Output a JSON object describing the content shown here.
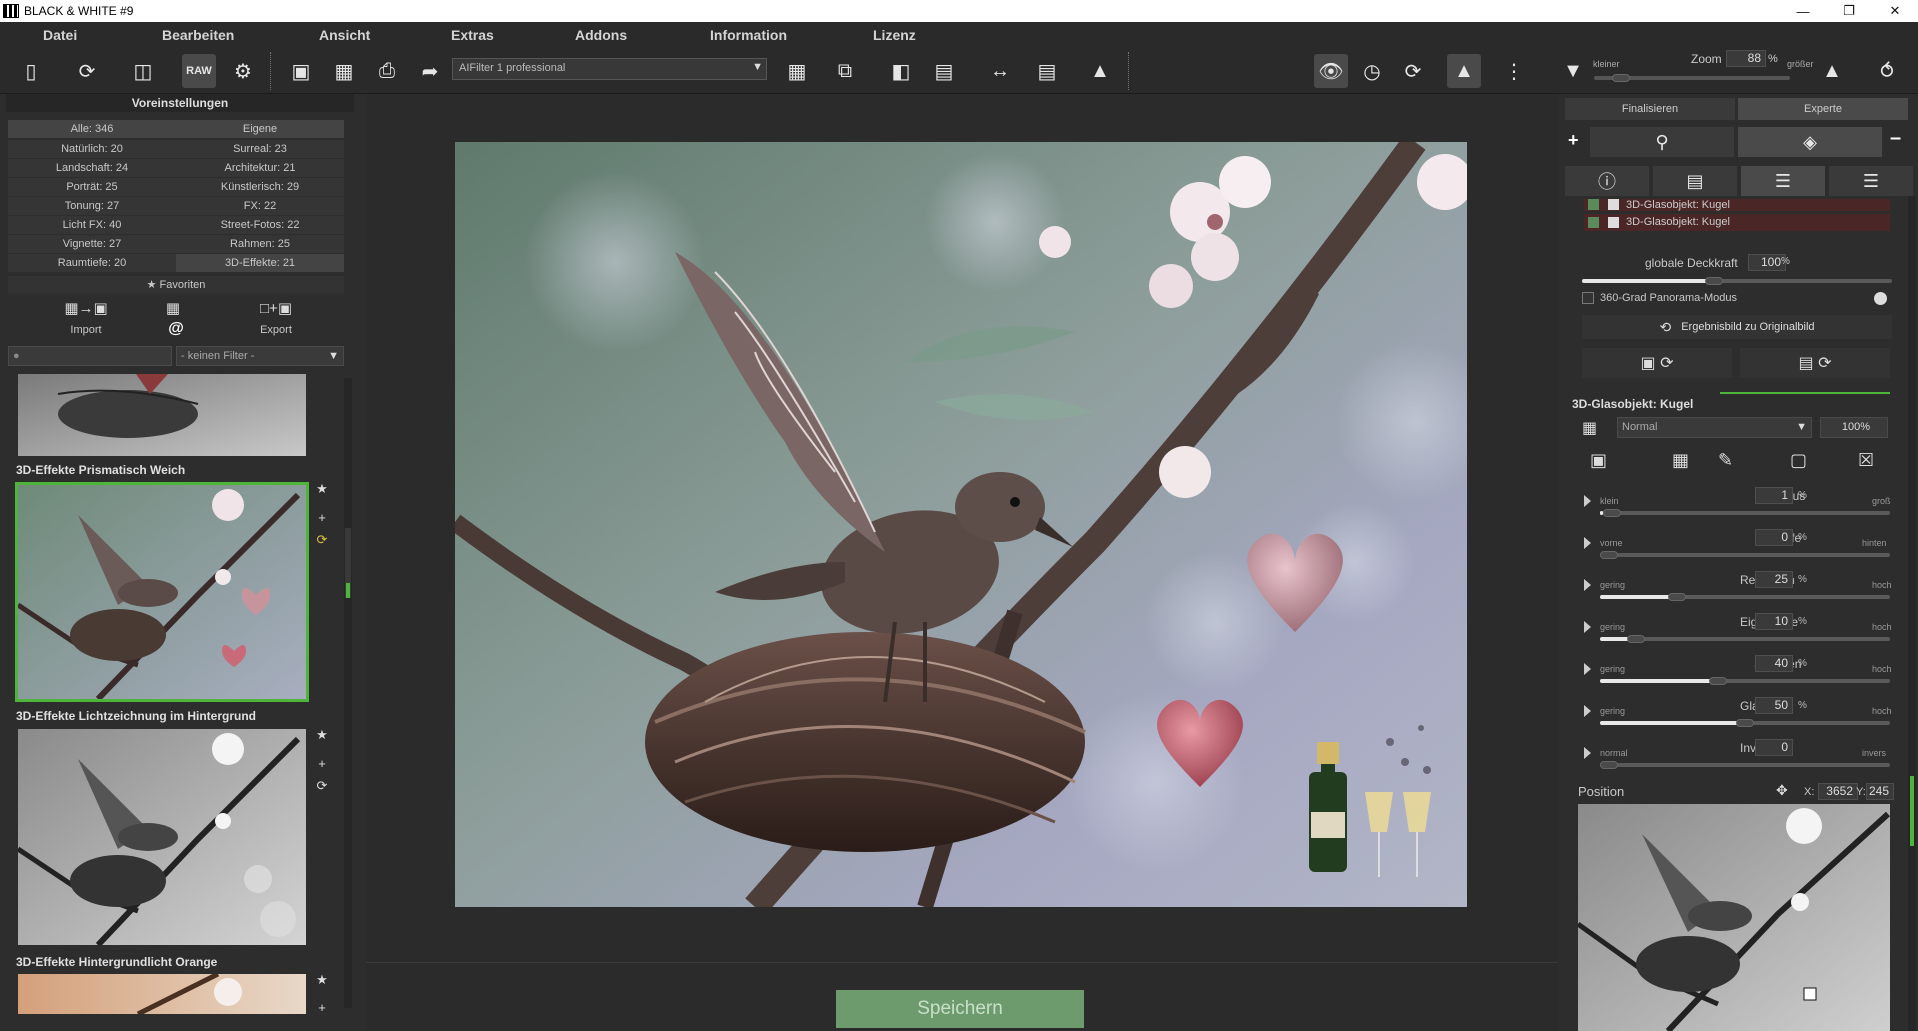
{
  "window": {
    "title": "BLACK & WHITE #9"
  },
  "menu": [
    "Datei",
    "Bearbeiten",
    "Ansicht",
    "Extras",
    "Addons",
    "Information",
    "Lizenz"
  ],
  "toolbar": {
    "filter_value": "AIFilter 1 professional",
    "raw_label": "RAW",
    "zoom_smaller": "kleiner",
    "zoom_label": "Zoom",
    "zoom_value": "88",
    "zoom_unit": "%",
    "zoom_bigger": "größer"
  },
  "presets": {
    "header": "Voreinstellungen",
    "categories_left": [
      "Alle: 346",
      "Natürlich: 20",
      "Landschaft: 24",
      "Porträt: 25",
      "Tonung: 27",
      "Licht FX: 40",
      "Vignette: 27",
      "Raumtiefe: 20"
    ],
    "categories_right": [
      "Eigene",
      "Surreal: 23",
      "Architektur: 21",
      "Künstlerisch: 29",
      "FX: 22",
      "Street-Fotos: 22",
      "Rahmen: 25",
      "3D-Effekte: 21"
    ],
    "favorites": "Favoriten",
    "import_label": "Import",
    "export_label": "Export",
    "filter_placeholder": "- keinen Filter -",
    "items": [
      {
        "title": "3D-Effekte Prismatisch Weich"
      },
      {
        "title": "3D-Effekte Lichtzeichnung im Hintergrund"
      },
      {
        "title": "3D-Effekte Hintergrundlicht Orange"
      }
    ]
  },
  "save_label": "Speichern",
  "right": {
    "tabs": [
      "Finalisieren",
      "Experte"
    ],
    "layers": [
      "3D-Glasobjekt: Kugel",
      "3D-Glasobjekt: Kugel"
    ],
    "opacity_label": "globale Deckkraft",
    "opacity_value": "100",
    "opacity_unit": "%",
    "opacity_fraction": 1.0,
    "panorama_label": "360-Grad Panorama-Modus",
    "result_label": "Ergebnisbild zu Originalbild",
    "section_title": "3D-Glasobjekt: Kugel",
    "blend_mode": "Normal",
    "blend_percent": "100%",
    "params": [
      {
        "name": "Radius",
        "value": "1",
        "unit": "%",
        "lo": "klein",
        "hi": "groß",
        "fraction": 0.01
      },
      {
        "name": "Tiefe",
        "value": "0",
        "unit": "%",
        "lo": "vorne",
        "hi": "hinten",
        "fraction": 0.0
      },
      {
        "name": "Refraktion",
        "value": "25",
        "unit": "%",
        "lo": "gering",
        "hi": "hoch",
        "fraction": 0.25
      },
      {
        "name": "Eigenfarbe",
        "value": "10",
        "unit": "%",
        "lo": "gering",
        "hi": "hoch",
        "fraction": 0.1
      },
      {
        "name": "Schatten",
        "value": "40",
        "unit": "%",
        "lo": "gering",
        "hi": "hoch",
        "fraction": 0.4
      },
      {
        "name": "Glanzlicht",
        "value": "50",
        "unit": "%",
        "lo": "gering",
        "hi": "hoch",
        "fraction": 0.5
      },
      {
        "name": "Invertiert",
        "value": "0",
        "unit": "",
        "lo": "normal",
        "hi": "invers",
        "fraction": 0.0
      }
    ],
    "position_label": "Position",
    "pos_x_label": "X:",
    "pos_x": "3652",
    "pos_y_label": "Y:",
    "pos_y": "245"
  },
  "colors": {
    "accent_green": "#4cb53a",
    "save_button": "#6e9b6e",
    "layer_bg": "#4a2626"
  }
}
